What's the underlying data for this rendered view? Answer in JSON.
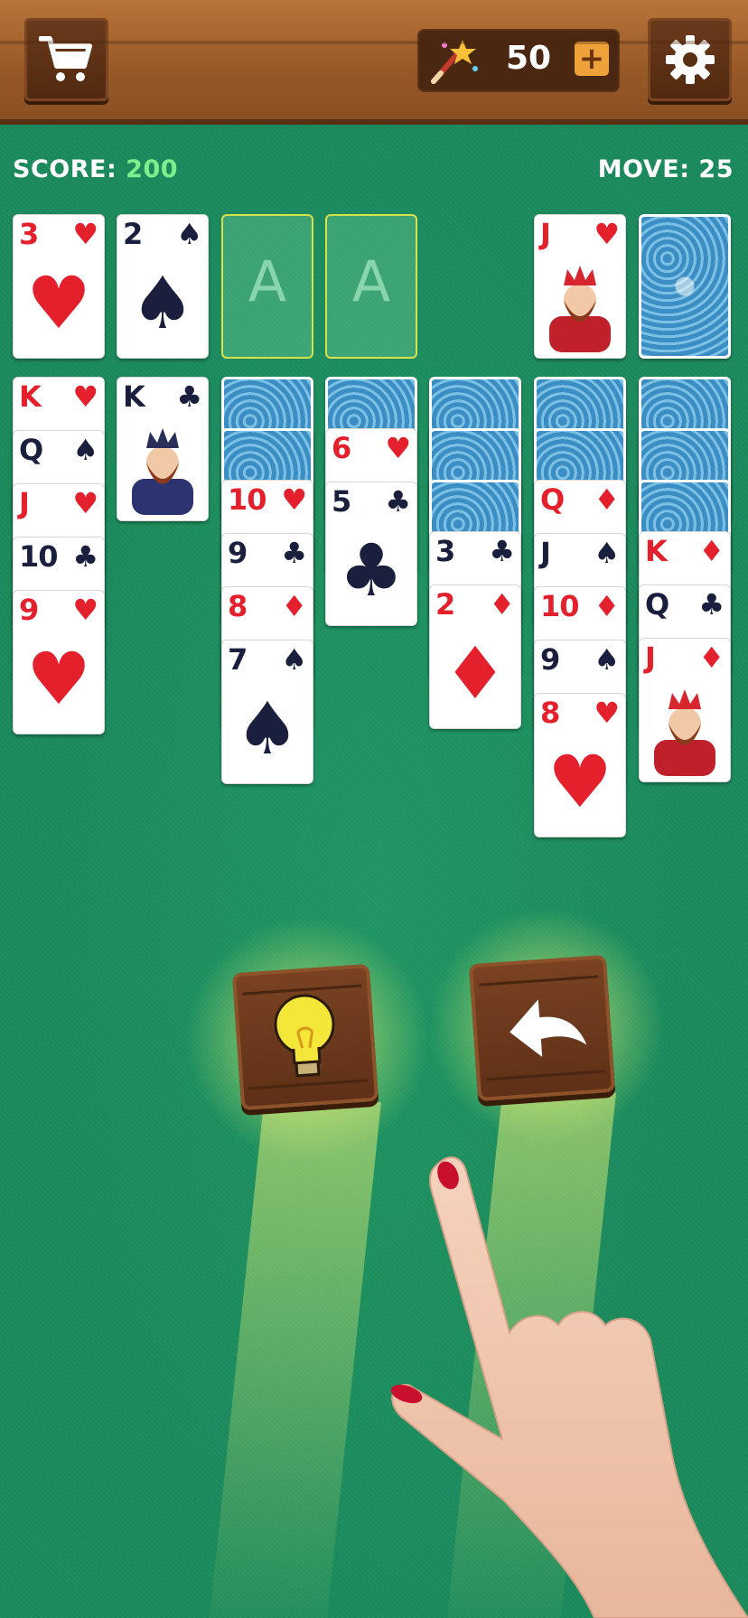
{
  "header": {
    "cart_icon": "shopping-cart-icon",
    "wallet": {
      "icon": "magic-wand-icon",
      "amount": "50",
      "add_label": "+"
    },
    "settings_icon": "gear-icon"
  },
  "hud": {
    "score_label": "SCORE: ",
    "score_value": "200",
    "move_label": "MOVE: ",
    "move_value": "25",
    "score_color": "#7cf08c"
  },
  "foundations": [
    {
      "rank": "3",
      "suit": "♥",
      "color": "red"
    },
    {
      "rank": "2",
      "suit": "♠",
      "color": "black"
    },
    {
      "placeholder": "A"
    },
    {
      "placeholder": "A"
    }
  ],
  "waste": {
    "rank": "J",
    "suit": "♥",
    "color": "red"
  },
  "stock": {
    "face_down": true
  },
  "tableau": [
    {
      "cards": [
        {
          "rank": "K",
          "suit": "♥",
          "color": "red"
        },
        {
          "rank": "Q",
          "suit": "♠",
          "color": "black"
        },
        {
          "rank": "J",
          "suit": "♥",
          "color": "red"
        },
        {
          "rank": "10",
          "suit": "♣",
          "color": "black"
        },
        {
          "rank": "9",
          "suit": "♥",
          "color": "red"
        }
      ]
    },
    {
      "cards": [
        {
          "rank": "K",
          "suit": "♣",
          "color": "black"
        }
      ]
    },
    {
      "hidden": 2,
      "cards": [
        {
          "rank": "10",
          "suit": "♥",
          "color": "red"
        },
        {
          "rank": "9",
          "suit": "♣",
          "color": "black"
        },
        {
          "rank": "8",
          "suit": "♦",
          "color": "red"
        },
        {
          "rank": "7",
          "suit": "♠",
          "color": "black"
        }
      ]
    },
    {
      "hidden": 1,
      "cards": [
        {
          "rank": "6",
          "suit": "♥",
          "color": "red"
        },
        {
          "rank": "5",
          "suit": "♣",
          "color": "black"
        }
      ]
    },
    {
      "hidden": 3,
      "cards": [
        {
          "rank": "3",
          "suit": "♣",
          "color": "black"
        },
        {
          "rank": "2",
          "suit": "♦",
          "color": "red"
        }
      ]
    },
    {
      "hidden": 2,
      "cards": [
        {
          "rank": "Q",
          "suit": "♦",
          "color": "red"
        },
        {
          "rank": "J",
          "suit": "♠",
          "color": "black"
        },
        {
          "rank": "10",
          "suit": "♦",
          "color": "red"
        },
        {
          "rank": "9",
          "suit": "♠",
          "color": "black"
        },
        {
          "rank": "8",
          "suit": "♥",
          "color": "red"
        }
      ]
    },
    {
      "hidden": 3,
      "cards": [
        {
          "rank": "K",
          "suit": "♦",
          "color": "red"
        },
        {
          "rank": "Q",
          "suit": "♣",
          "color": "black"
        },
        {
          "rank": "J",
          "suit": "♦",
          "color": "red"
        }
      ]
    }
  ],
  "controls": {
    "hint_icon": "lightbulb-icon",
    "undo_icon": "undo-arrow-icon",
    "tutorial_icon": "pointing-hand-icon"
  }
}
